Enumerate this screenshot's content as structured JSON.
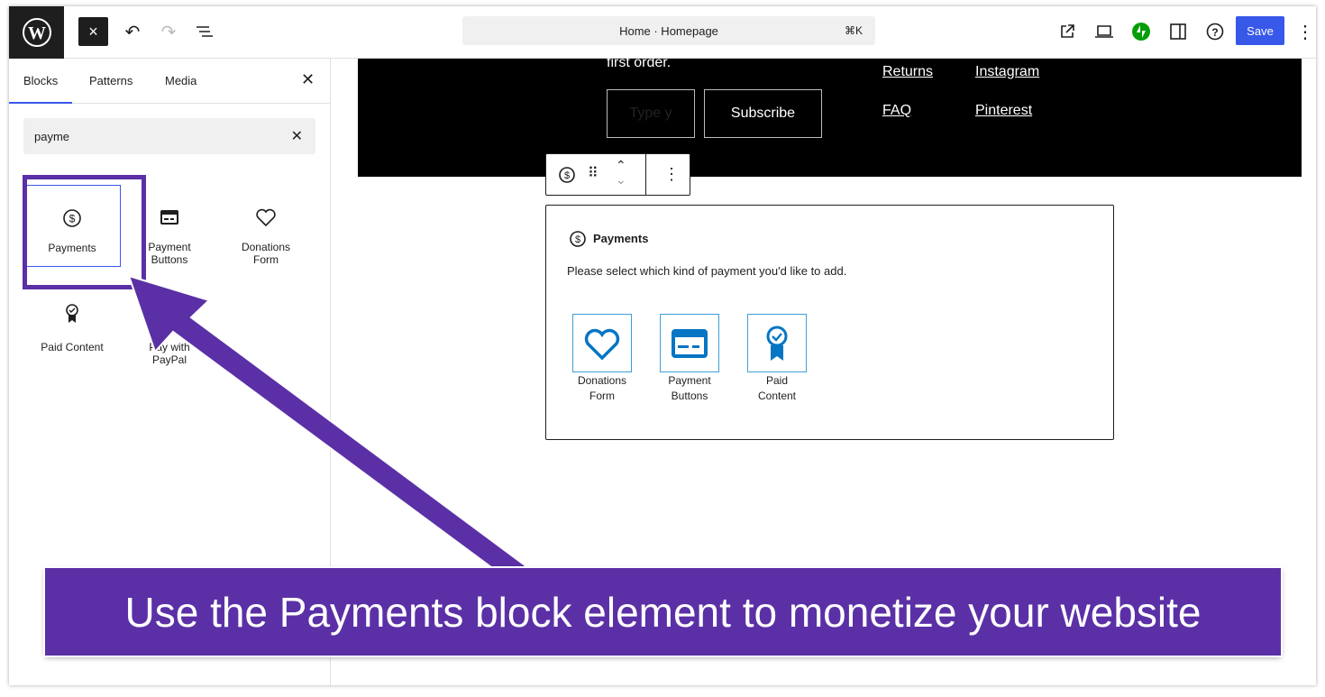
{
  "topbar": {
    "close_label": "×",
    "command": "Home · Homepage",
    "shortcut": "⌘K",
    "save": "Save"
  },
  "sidebar": {
    "tabs": [
      "Blocks",
      "Patterns",
      "Media"
    ],
    "search_value": "payme",
    "blocks": [
      {
        "label": "Payments",
        "icon": "dollar-circle-icon"
      },
      {
        "label": "Payment Buttons",
        "icon": "credit-card-icon"
      },
      {
        "label": "Donations Form",
        "icon": "heart-icon"
      },
      {
        "label": "Paid Content",
        "icon": "award-icon"
      },
      {
        "label": "Pay with PayPal",
        "icon": "paypal-icon"
      }
    ]
  },
  "canvas": {
    "footer_text": "first order.",
    "email_placeholder": "Type y",
    "subscribe": "Subscribe",
    "links": [
      "Returns",
      "Instagram",
      "FAQ",
      "Pinterest"
    ],
    "payments_block": {
      "title": "Payments",
      "instruction": "Please select which kind of payment you'd like to add.",
      "options": [
        "Donations Form",
        "Payment Buttons",
        "Paid Content"
      ]
    }
  },
  "banner": "Use the Payments block element to monetize your website",
  "colors": {
    "accent": "#3858e9",
    "annotation": "#5b30a6",
    "option_blue": "#0675c4",
    "jetpack": "#069e08"
  }
}
